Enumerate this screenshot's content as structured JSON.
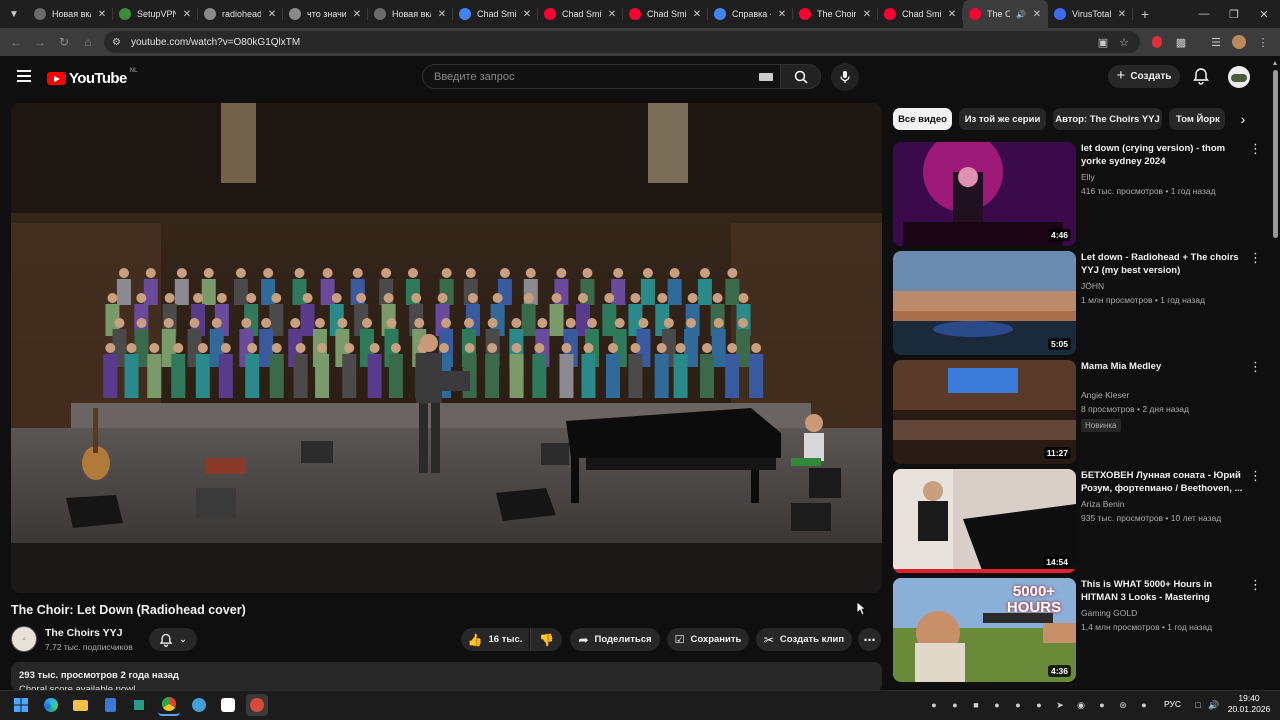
{
  "browser": {
    "tabs": [
      {
        "title": "Новая вкл",
        "color": "#6b6b6b"
      },
      {
        "title": "SetupVPN",
        "color": "#3a8c3a"
      },
      {
        "title": "radiohead",
        "color": "#8a8a8a"
      },
      {
        "title": "что значит",
        "color": "#8a8a8a"
      },
      {
        "title": "Новая вкл",
        "color": "#6b6b6b"
      },
      {
        "title": "Chad Smit",
        "color": "#4285f4"
      },
      {
        "title": "Chad Smit",
        "color": "#ff0033"
      },
      {
        "title": "Chad Smit",
        "color": "#ff0033"
      },
      {
        "title": "Справка -",
        "color": "#4285f4"
      },
      {
        "title": "The Choir",
        "color": "#ff0033"
      },
      {
        "title": "Chad Smit",
        "color": "#ff0033"
      },
      {
        "title": "The Ch",
        "color": "#ff0033",
        "active": true
      },
      {
        "title": "VirusTotal",
        "color": "#3b6cf2"
      }
    ],
    "url": "youtube.com/watch?v=O80kG1QlxTM"
  },
  "youtube": {
    "logo_text": "YouTube",
    "country_code": "NL",
    "search_placeholder": "Введите запрос",
    "create_label": "Создать"
  },
  "video": {
    "title": "The Choir: Let Down (Radiohead cover)",
    "channel": "The Choirs YYJ",
    "subscribers": "7,72 тыс. подписчиков",
    "likes": "16 тыс.",
    "share_label": "Поделиться",
    "save_label": "Сохранить",
    "clip_label": "Создать клип",
    "stats": "293 тыс. просмотров  2 года назад",
    "description_preview": "Choral score available now!"
  },
  "chips": [
    "Все видео",
    "Из той же серии",
    "Автор: The Choirs YYJ",
    "Том Йорк"
  ],
  "recommendations": [
    {
      "title": "let down (crying version) - thom yorke sydney 2024",
      "channel": "Elly",
      "meta": "416 тыс. просмотров • 1 год назад",
      "duration": "4:46",
      "badge": ""
    },
    {
      "title": "Let down - Radiohead + The choirs YYJ (my best version)",
      "channel": "JÖHN",
      "meta": "1 млн просмотров • 1 год назад",
      "duration": "5:05",
      "badge": ""
    },
    {
      "title": "Mama Mia Medley",
      "channel": "Angie Kleser",
      "meta": "8 просмотров • 2 дня назад",
      "duration": "11:27",
      "badge": "Новинка"
    },
    {
      "title": "БЕТХОВЕН Лунная соната - Юрий Розум, фортепиано / Beethoven, ...",
      "channel": "Ariza Benin",
      "meta": "935 тыс. просмотров • 10 лет назад",
      "duration": "14:54",
      "badge": ""
    },
    {
      "title": "This is WHAT 5000+ Hours in HITMAN 3 Looks - Mastering Sapienza",
      "channel": "Gaming GOLD",
      "meta": "1,4 млн просмотров • 1 год назад",
      "duration": "4:36",
      "badge": "",
      "thumb_text": "5000+ HOURS"
    }
  ],
  "taskbar": {
    "lang": "РУС",
    "time": "19:40",
    "date": "20.01.2026"
  },
  "colors": {
    "bg": "#0f0f0f",
    "pill": "#272727",
    "yt_red": "#ff0000"
  }
}
